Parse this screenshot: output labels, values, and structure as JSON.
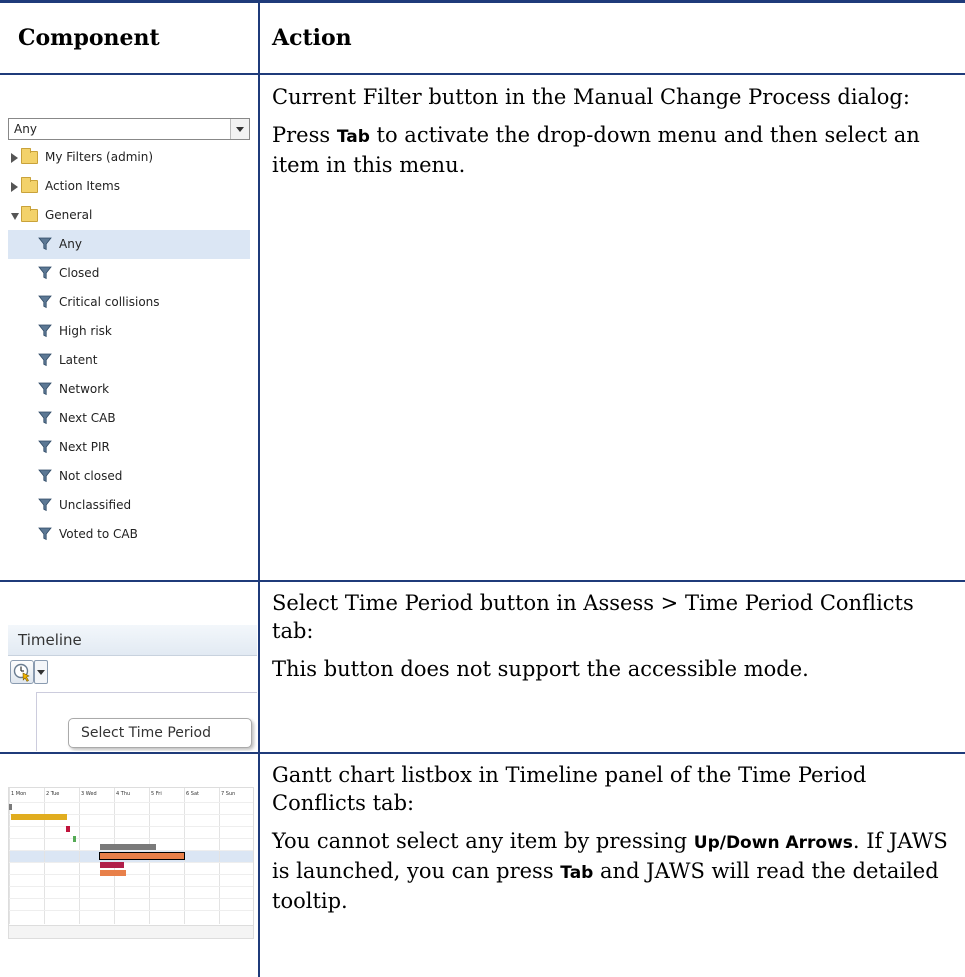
{
  "table": {
    "col_component": "Component",
    "col_action": "Action"
  },
  "rows": [
    {
      "action_paragraphs": [
        "Current Filter button in the Manual Change Process dialog:"
      ],
      "action_line2_pre": "Press ",
      "action_line2_key": "Tab",
      "action_line2_post": " to activate the drop-down menu and then select an item in this menu."
    },
    {
      "action_p1": "Select Time Period button in Assess > Time Period Conflicts tab:",
      "action_p2": "This button does not support the accessible mode."
    },
    {
      "action_p1": "Gantt chart listbox in Timeline panel of the Time Period Conflicts tab:",
      "action_p2_pre": "You cannot select any item by pressing ",
      "action_p2_key1": "Up/Down Arrows",
      "action_p2_mid": ". If JAWS is launched, you can press ",
      "action_p2_key2": "Tab",
      "action_p2_post": " and JAWS will read the detailed tooltip."
    }
  ],
  "filter_widget": {
    "combo_value": "Any",
    "folders": [
      {
        "label": "My Filters (admin)",
        "expanded": false
      },
      {
        "label": "Action Items",
        "expanded": false
      },
      {
        "label": "General",
        "expanded": true
      }
    ],
    "filters": [
      {
        "label": "Any",
        "selected": true,
        "icon": "filter-icon"
      },
      {
        "label": "Closed",
        "icon": "filter-icon"
      },
      {
        "label": "Critical collisions",
        "icon": "filter-icon"
      },
      {
        "label": "High risk",
        "icon": "filter-icon"
      },
      {
        "label": "Latent",
        "icon": "filter-icon"
      },
      {
        "label": "Network",
        "icon": "filter-icon"
      },
      {
        "label": "Next CAB",
        "icon": "filter-icon"
      },
      {
        "label": "Next PIR",
        "icon": "filter-icon"
      },
      {
        "label": "Not closed",
        "icon": "filter-icon"
      },
      {
        "label": "Unclassified",
        "icon": "filter-icon"
      },
      {
        "label": "Voted to CAB",
        "icon": "filter-icon"
      }
    ]
  },
  "timeline_widget": {
    "title": "Timeline",
    "tooltip": "Select Time Period",
    "button_icon": "clock-cursor-icon"
  },
  "gantt_widget": {
    "days": [
      "1 Mon",
      "2 Tue",
      "3 Wed",
      "4 Thu",
      "5 Fri",
      "6 Sat",
      "7 Sun"
    ],
    "bar_colors": [
      "#e1ad1f",
      "#c0143c",
      "#7a7a7a",
      "#e8804a",
      "#b01e4a",
      "#e8804a",
      "#55aa55"
    ]
  },
  "colors": {
    "rule": "#1f3b7a",
    "selection": "#dbe6f4"
  }
}
